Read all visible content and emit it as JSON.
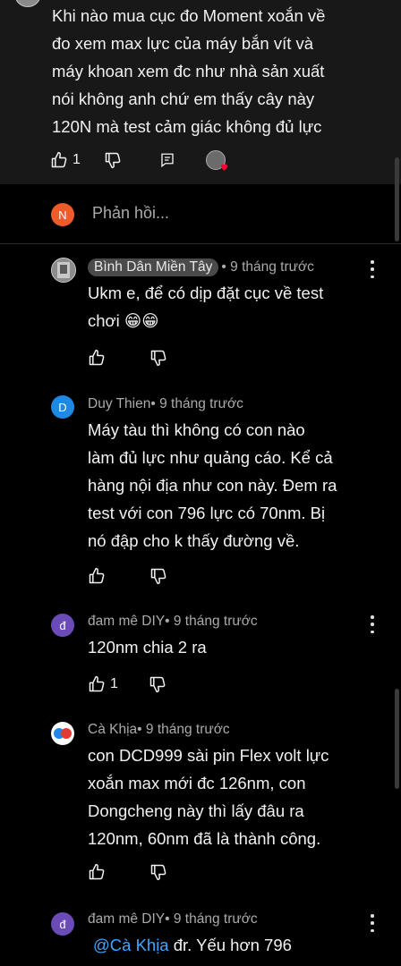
{
  "parent_comment": {
    "lines": [
      "Khi nào mua cục đo Moment xoắn về",
      "đo xem max lực của máy bắn vít và",
      "máy khoan xem đc như nhà sản xuất",
      "nói không anh chứ em thấy cây này",
      "120N mà test cảm giác không đủ lực"
    ],
    "like_count": "1"
  },
  "reply_input": {
    "avatar_letter": "N",
    "placeholder": "Phản hồi..."
  },
  "replies": [
    {
      "author": "Bình Dân Miền Tây",
      "time": " • 9 tháng trước",
      "lines": [
        "Ukm e, để có dịp đặt cục về test",
        "chơi 😁😁"
      ],
      "like_count": ""
    },
    {
      "author": "Duy Thien",
      "avatar_letter": "D",
      "time": " • 9 tháng trước",
      "lines": [
        "Máy tàu thì không có con nào",
        "làm đủ lực như quảng cáo. Kể cả",
        "hàng nội địa như con này. Đem ra",
        "test với con 796 lực có 70nm. Bị",
        "nó đập cho k thấy đường về."
      ],
      "like_count": ""
    },
    {
      "author": "đam mê DIY",
      "avatar_letter": "đ",
      "time": " • 9 tháng trước",
      "lines": [
        "120nm chia 2 ra"
      ],
      "like_count": "1"
    },
    {
      "author": "Cà Khịa",
      "time": " • 9 tháng trước",
      "lines": [
        "con DCD999 sài pin Flex volt lực",
        "xoắn max mới đc 126nm, con",
        "Dongcheng này thì lấy đâu ra",
        "120nm, 60nm đã là thành công."
      ],
      "like_count": ""
    },
    {
      "author": "đam mê DIY",
      "avatar_letter": "đ",
      "time": " • 9 tháng trước",
      "mention": "@Cà Khịa",
      "text_after_mention": " đr. Yếu hơn 796"
    }
  ],
  "colors": {
    "background": "#000000",
    "card": "#181818",
    "text": "#f1f1f1",
    "meta": "#aaaaaa",
    "mention": "#3ea6ff",
    "reply_avatar": "#ef5b2a",
    "duy_avatar": "#1e88e5",
    "diy_avatar": "#6a4bb8"
  }
}
